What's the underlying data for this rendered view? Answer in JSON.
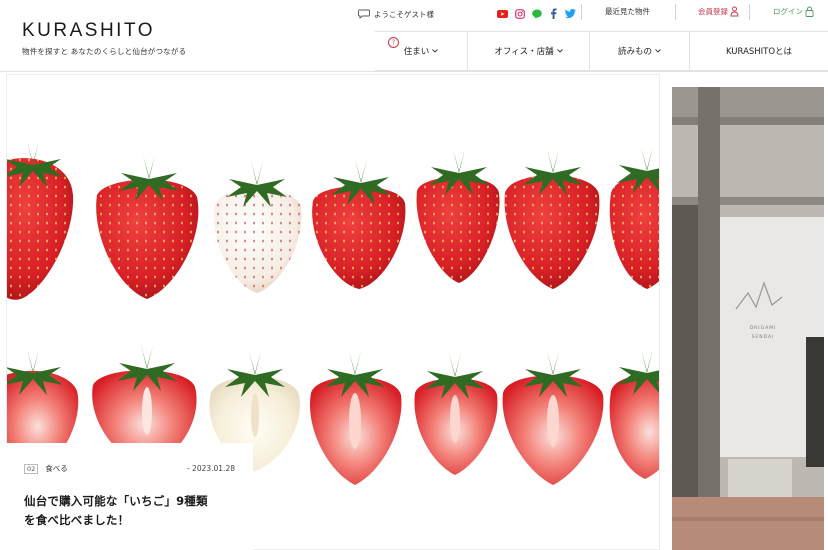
{
  "site": {
    "logo": "KURASHITO",
    "tagline": "物件を探すと あなたのくらしと仙台がつながる"
  },
  "header": {
    "greeting": "ようこそゲスト様",
    "recent": "最近見た物件",
    "signup": "会員登録",
    "login": "ログイン"
  },
  "nav": {
    "items": [
      {
        "label": "住まい"
      },
      {
        "label": "オフィス・店舗"
      },
      {
        "label": "読みもの"
      },
      {
        "label": "KURASHITOとは"
      }
    ]
  },
  "colors": {
    "accent_red": "#c4374a",
    "accent_green": "#4c9c5a",
    "strawberry": "#d81f26"
  },
  "icons": [
    "chat-icon",
    "youtube-icon",
    "instagram-icon",
    "line-icon",
    "facebook-icon",
    "twitter-icon",
    "chevron-down-icon",
    "question-icon"
  ],
  "article": {
    "number": "02",
    "category": "食べる",
    "date": "- 2023.01.28",
    "title_line1": "仙台で購入可能な「いちご」9種類",
    "title_line2": "を食べ比べました！"
  },
  "side_photo": {
    "line1": "ORIGAMI",
    "line2": "SENDAI"
  }
}
